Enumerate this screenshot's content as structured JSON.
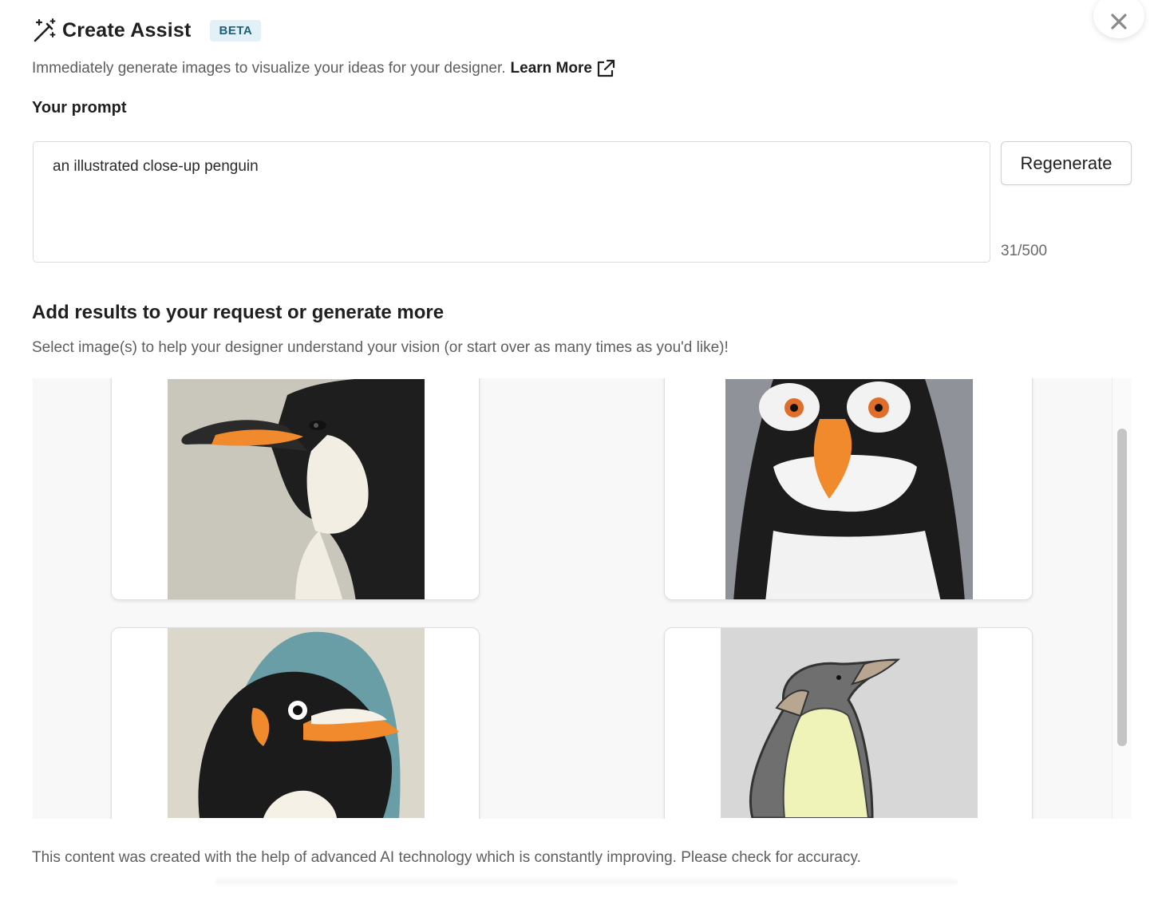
{
  "dialog": {
    "title": "Create Assist",
    "badge": "BETA",
    "close_icon": "close-icon",
    "title_icon": "magic-wand-icon"
  },
  "intro": {
    "text": "Immediately generate images to visualize your ideas for your designer.",
    "learn_more": "Learn More",
    "learn_more_icon": "external-link-icon"
  },
  "prompt": {
    "label": "Your prompt",
    "value": "an illustrated close-up penguin",
    "counter": "31/500",
    "regenerate_label": "Regenerate"
  },
  "results": {
    "title": "Add results to your request or generate more",
    "subtitle": "Select image(s) to help your designer understand your vision (or start over as many times as you'd like)!",
    "images": [
      {
        "name": "penguin-side-profile-image"
      },
      {
        "name": "penguin-front-face-image"
      },
      {
        "name": "penguin-teal-background-image"
      },
      {
        "name": "penguin-sketch-image"
      }
    ]
  },
  "footer": {
    "disclaimer": "This content was created with the help of advanced AI technology which is constantly improving. Please check for accuracy."
  },
  "colors": {
    "badge_bg": "#e2f1f7",
    "badge_text": "#1d5f78",
    "penguin_orange": "#f08a2c"
  }
}
